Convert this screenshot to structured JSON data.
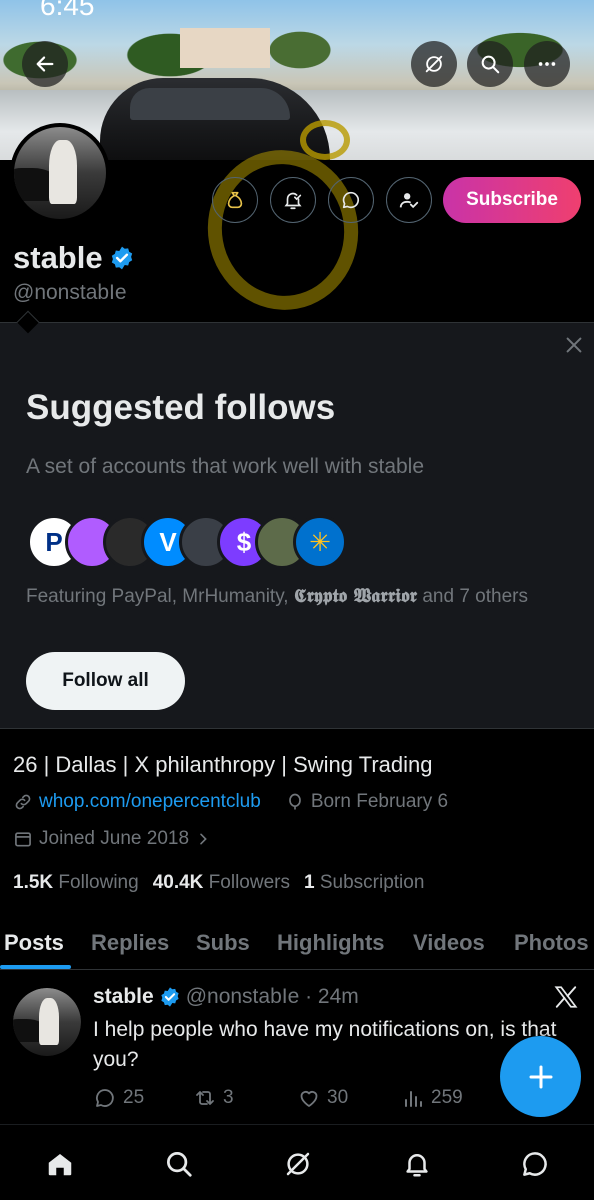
{
  "status_bar": {
    "time": "6:45"
  },
  "profile": {
    "display_name": "stable",
    "handle": "@nonstabIe",
    "subscribe_label": "Subscribe"
  },
  "suggested": {
    "title": "Suggested follows",
    "subtitle": "A set of accounts that work well with stable",
    "featuring_prefix": "Featuring PayPal, MrHumanity, ",
    "featuring_gothic": "𝕮𝖗𝖞𝖕𝖙𝖔 𝖂𝖆𝖗𝖗𝖎𝖔𝖗",
    "featuring_suffix": " and 7 others",
    "follow_all_label": "Follow all",
    "avatars": [
      {
        "name": "PayPal",
        "glyph": "P",
        "bg": "#ffffff",
        "fg": "#003087"
      },
      {
        "name": "MrHumanity",
        "glyph": "",
        "bg": "#b05cff",
        "fg": "#ffffff"
      },
      {
        "name": "Crypto Warrior",
        "glyph": "",
        "bg": "#2a2a2a",
        "fg": "#ffffff"
      },
      {
        "name": "Venmo",
        "glyph": "V",
        "bg": "#008cff",
        "fg": "#ffffff"
      },
      {
        "name": "Suit",
        "glyph": "",
        "bg": "#3a3f47",
        "fg": "#ffffff"
      },
      {
        "name": "Cash",
        "glyph": "$",
        "bg": "#7d3cff",
        "fg": "#ffffff"
      },
      {
        "name": "Nature",
        "glyph": "",
        "bg": "#5d6b4a",
        "fg": "#ffffff"
      },
      {
        "name": "Walmart",
        "glyph": "✳",
        "bg": "#0071ce",
        "fg": "#ffc220"
      }
    ]
  },
  "bio": {
    "text": "26 | Dallas | X philanthropy | Swing Trading",
    "link": "whop.com/onepercentclub",
    "born": "Born February 6",
    "joined": "Joined June 2018"
  },
  "stats": {
    "following_count": "1.5K",
    "following_label": "Following",
    "followers_count": "40.4K",
    "followers_label": "Followers",
    "subs_count": "1",
    "subs_label": "Subscription"
  },
  "tabs": [
    "Posts",
    "Replies",
    "Subs",
    "Highlights",
    "Videos",
    "Photos"
  ],
  "post": {
    "name": "stable",
    "meta": "@nonstabIe · 24m",
    "text": "I help people who have my notifications on, is that you?",
    "replies": "25",
    "reposts": "3",
    "likes": "30",
    "views": "259"
  },
  "colors": {
    "accent": "#1d9bf0",
    "subscribe_start": "#c933a8",
    "subscribe_end": "#ef3f6f"
  }
}
